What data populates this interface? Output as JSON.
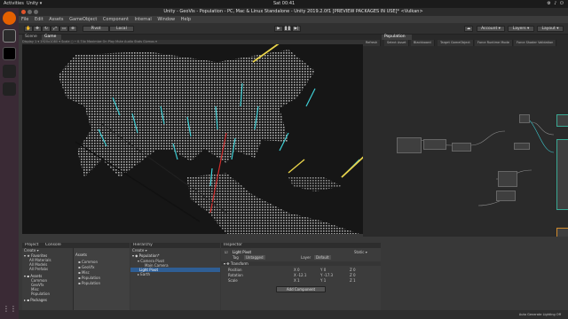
{
  "system": {
    "activities": "Activities",
    "app_name": "Unity ▾",
    "clock": "Sat 00:41",
    "tray": "⚙ ♪ ⏻"
  },
  "window": {
    "title": "Unity - GeoVis - Population - PC, Mac & Linux Standalone - Unity 2019.2.0f1 [PREVIEW PACKAGES IN USE]* <Vulkan>"
  },
  "menu": [
    "File",
    "Edit",
    "Assets",
    "GameObject",
    "Component",
    "Internal",
    "Window",
    "Help"
  ],
  "toolbar": {
    "pivot": "Pivot",
    "local": "Local",
    "account": "Account ▾",
    "layers": "Layers ▾",
    "layout": "Layout ▾"
  },
  "scene_tabs": [
    "Scene",
    "Game"
  ],
  "scene_subbar": "Display 1 ▾   1920x1080 ▾    Scale ○ ─ 0.74x     Maximize On Play  Mute Audio  Stats  Gizmos ▾",
  "graph": {
    "tab": "Population",
    "tools": [
      "Refresh",
      "Select Asset",
      "Blackboard",
      "Target GameObject",
      "Force Runtime Mode",
      "Force Shader Validation"
    ]
  },
  "project": {
    "tabs": [
      "Project",
      "Console"
    ],
    "create": "Create ▾",
    "favorites_label": "Favorites",
    "favorites": [
      "All Materials",
      "All Models",
      "All Prefabs"
    ],
    "assets_label": "Assets",
    "assets_tree": [
      "Common",
      "GeoVfx",
      "Misc",
      "Population"
    ],
    "packages_label": "Packages",
    "assets_list_header": "Assets",
    "assets_list": [
      "Common",
      "GeoVfx",
      "Misc",
      "Population",
      "Population"
    ]
  },
  "hierarchy": {
    "tab": "Hierarchy",
    "create": "Create ▾",
    "scene": "Population*",
    "items": [
      "Camera Pivot",
      "Main Camera",
      "Light Pivot",
      "Earth"
    ]
  },
  "inspector": {
    "tab": "Inspector",
    "object_name": "Light Pivot",
    "static": "Static ▾",
    "tag_label": "Tag",
    "tag_value": "Untagged",
    "layer_label": "Layer",
    "layer_value": "Default",
    "transform_label": "Transform",
    "position_label": "Position",
    "rotation_label": "Rotation",
    "scale_label": "Scale",
    "position": [
      "X 0",
      "Y 0",
      "Z 0"
    ],
    "rotation": [
      "X -12.1",
      "Y -17.3",
      "Z 0"
    ],
    "scale": [
      "X 1",
      "Y 1",
      "Z 1"
    ],
    "add_component": "Add Component"
  },
  "status": {
    "text": "Auto Generate Lighting Off"
  },
  "colors": {
    "accent_blue": "#2f7dd1",
    "spike_cyan": "#3fd0d6",
    "spike_yellow": "#e8d24a",
    "node_teal": "#3aa893",
    "node_orange": "#d08a2c"
  }
}
